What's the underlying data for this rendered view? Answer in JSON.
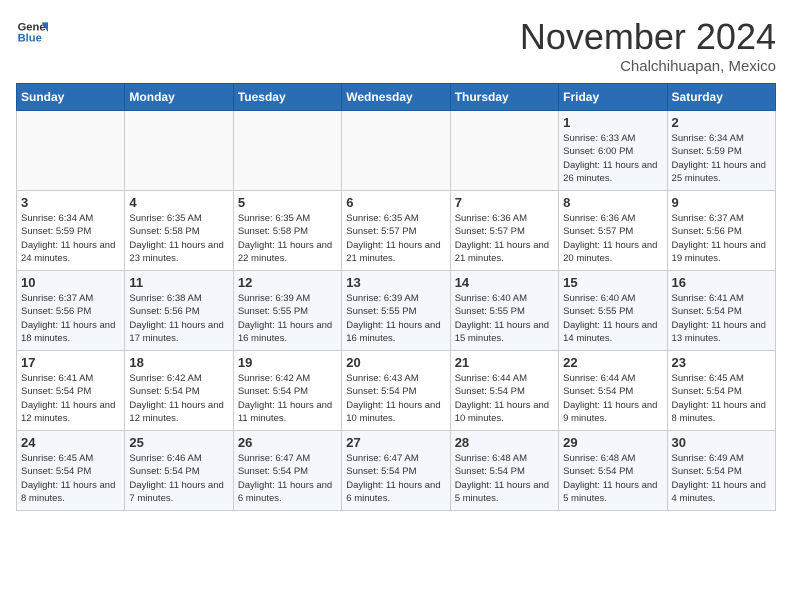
{
  "header": {
    "logo_general": "General",
    "logo_blue": "Blue",
    "month_title": "November 2024",
    "subtitle": "Chalchihuapan, Mexico"
  },
  "weekdays": [
    "Sunday",
    "Monday",
    "Tuesday",
    "Wednesday",
    "Thursday",
    "Friday",
    "Saturday"
  ],
  "weeks": [
    [
      {
        "day": "",
        "info": ""
      },
      {
        "day": "",
        "info": ""
      },
      {
        "day": "",
        "info": ""
      },
      {
        "day": "",
        "info": ""
      },
      {
        "day": "",
        "info": ""
      },
      {
        "day": "1",
        "info": "Sunrise: 6:33 AM\nSunset: 6:00 PM\nDaylight: 11 hours and 26 minutes."
      },
      {
        "day": "2",
        "info": "Sunrise: 6:34 AM\nSunset: 5:59 PM\nDaylight: 11 hours and 25 minutes."
      }
    ],
    [
      {
        "day": "3",
        "info": "Sunrise: 6:34 AM\nSunset: 5:59 PM\nDaylight: 11 hours and 24 minutes."
      },
      {
        "day": "4",
        "info": "Sunrise: 6:35 AM\nSunset: 5:58 PM\nDaylight: 11 hours and 23 minutes."
      },
      {
        "day": "5",
        "info": "Sunrise: 6:35 AM\nSunset: 5:58 PM\nDaylight: 11 hours and 22 minutes."
      },
      {
        "day": "6",
        "info": "Sunrise: 6:35 AM\nSunset: 5:57 PM\nDaylight: 11 hours and 21 minutes."
      },
      {
        "day": "7",
        "info": "Sunrise: 6:36 AM\nSunset: 5:57 PM\nDaylight: 11 hours and 21 minutes."
      },
      {
        "day": "8",
        "info": "Sunrise: 6:36 AM\nSunset: 5:57 PM\nDaylight: 11 hours and 20 minutes."
      },
      {
        "day": "9",
        "info": "Sunrise: 6:37 AM\nSunset: 5:56 PM\nDaylight: 11 hours and 19 minutes."
      }
    ],
    [
      {
        "day": "10",
        "info": "Sunrise: 6:37 AM\nSunset: 5:56 PM\nDaylight: 11 hours and 18 minutes."
      },
      {
        "day": "11",
        "info": "Sunrise: 6:38 AM\nSunset: 5:56 PM\nDaylight: 11 hours and 17 minutes."
      },
      {
        "day": "12",
        "info": "Sunrise: 6:39 AM\nSunset: 5:55 PM\nDaylight: 11 hours and 16 minutes."
      },
      {
        "day": "13",
        "info": "Sunrise: 6:39 AM\nSunset: 5:55 PM\nDaylight: 11 hours and 16 minutes."
      },
      {
        "day": "14",
        "info": "Sunrise: 6:40 AM\nSunset: 5:55 PM\nDaylight: 11 hours and 15 minutes."
      },
      {
        "day": "15",
        "info": "Sunrise: 6:40 AM\nSunset: 5:55 PM\nDaylight: 11 hours and 14 minutes."
      },
      {
        "day": "16",
        "info": "Sunrise: 6:41 AM\nSunset: 5:54 PM\nDaylight: 11 hours and 13 minutes."
      }
    ],
    [
      {
        "day": "17",
        "info": "Sunrise: 6:41 AM\nSunset: 5:54 PM\nDaylight: 11 hours and 12 minutes."
      },
      {
        "day": "18",
        "info": "Sunrise: 6:42 AM\nSunset: 5:54 PM\nDaylight: 11 hours and 12 minutes."
      },
      {
        "day": "19",
        "info": "Sunrise: 6:42 AM\nSunset: 5:54 PM\nDaylight: 11 hours and 11 minutes."
      },
      {
        "day": "20",
        "info": "Sunrise: 6:43 AM\nSunset: 5:54 PM\nDaylight: 11 hours and 10 minutes."
      },
      {
        "day": "21",
        "info": "Sunrise: 6:44 AM\nSunset: 5:54 PM\nDaylight: 11 hours and 10 minutes."
      },
      {
        "day": "22",
        "info": "Sunrise: 6:44 AM\nSunset: 5:54 PM\nDaylight: 11 hours and 9 minutes."
      },
      {
        "day": "23",
        "info": "Sunrise: 6:45 AM\nSunset: 5:54 PM\nDaylight: 11 hours and 8 minutes."
      }
    ],
    [
      {
        "day": "24",
        "info": "Sunrise: 6:45 AM\nSunset: 5:54 PM\nDaylight: 11 hours and 8 minutes."
      },
      {
        "day": "25",
        "info": "Sunrise: 6:46 AM\nSunset: 5:54 PM\nDaylight: 11 hours and 7 minutes."
      },
      {
        "day": "26",
        "info": "Sunrise: 6:47 AM\nSunset: 5:54 PM\nDaylight: 11 hours and 6 minutes."
      },
      {
        "day": "27",
        "info": "Sunrise: 6:47 AM\nSunset: 5:54 PM\nDaylight: 11 hours and 6 minutes."
      },
      {
        "day": "28",
        "info": "Sunrise: 6:48 AM\nSunset: 5:54 PM\nDaylight: 11 hours and 5 minutes."
      },
      {
        "day": "29",
        "info": "Sunrise: 6:48 AM\nSunset: 5:54 PM\nDaylight: 11 hours and 5 minutes."
      },
      {
        "day": "30",
        "info": "Sunrise: 6:49 AM\nSunset: 5:54 PM\nDaylight: 11 hours and 4 minutes."
      }
    ]
  ]
}
